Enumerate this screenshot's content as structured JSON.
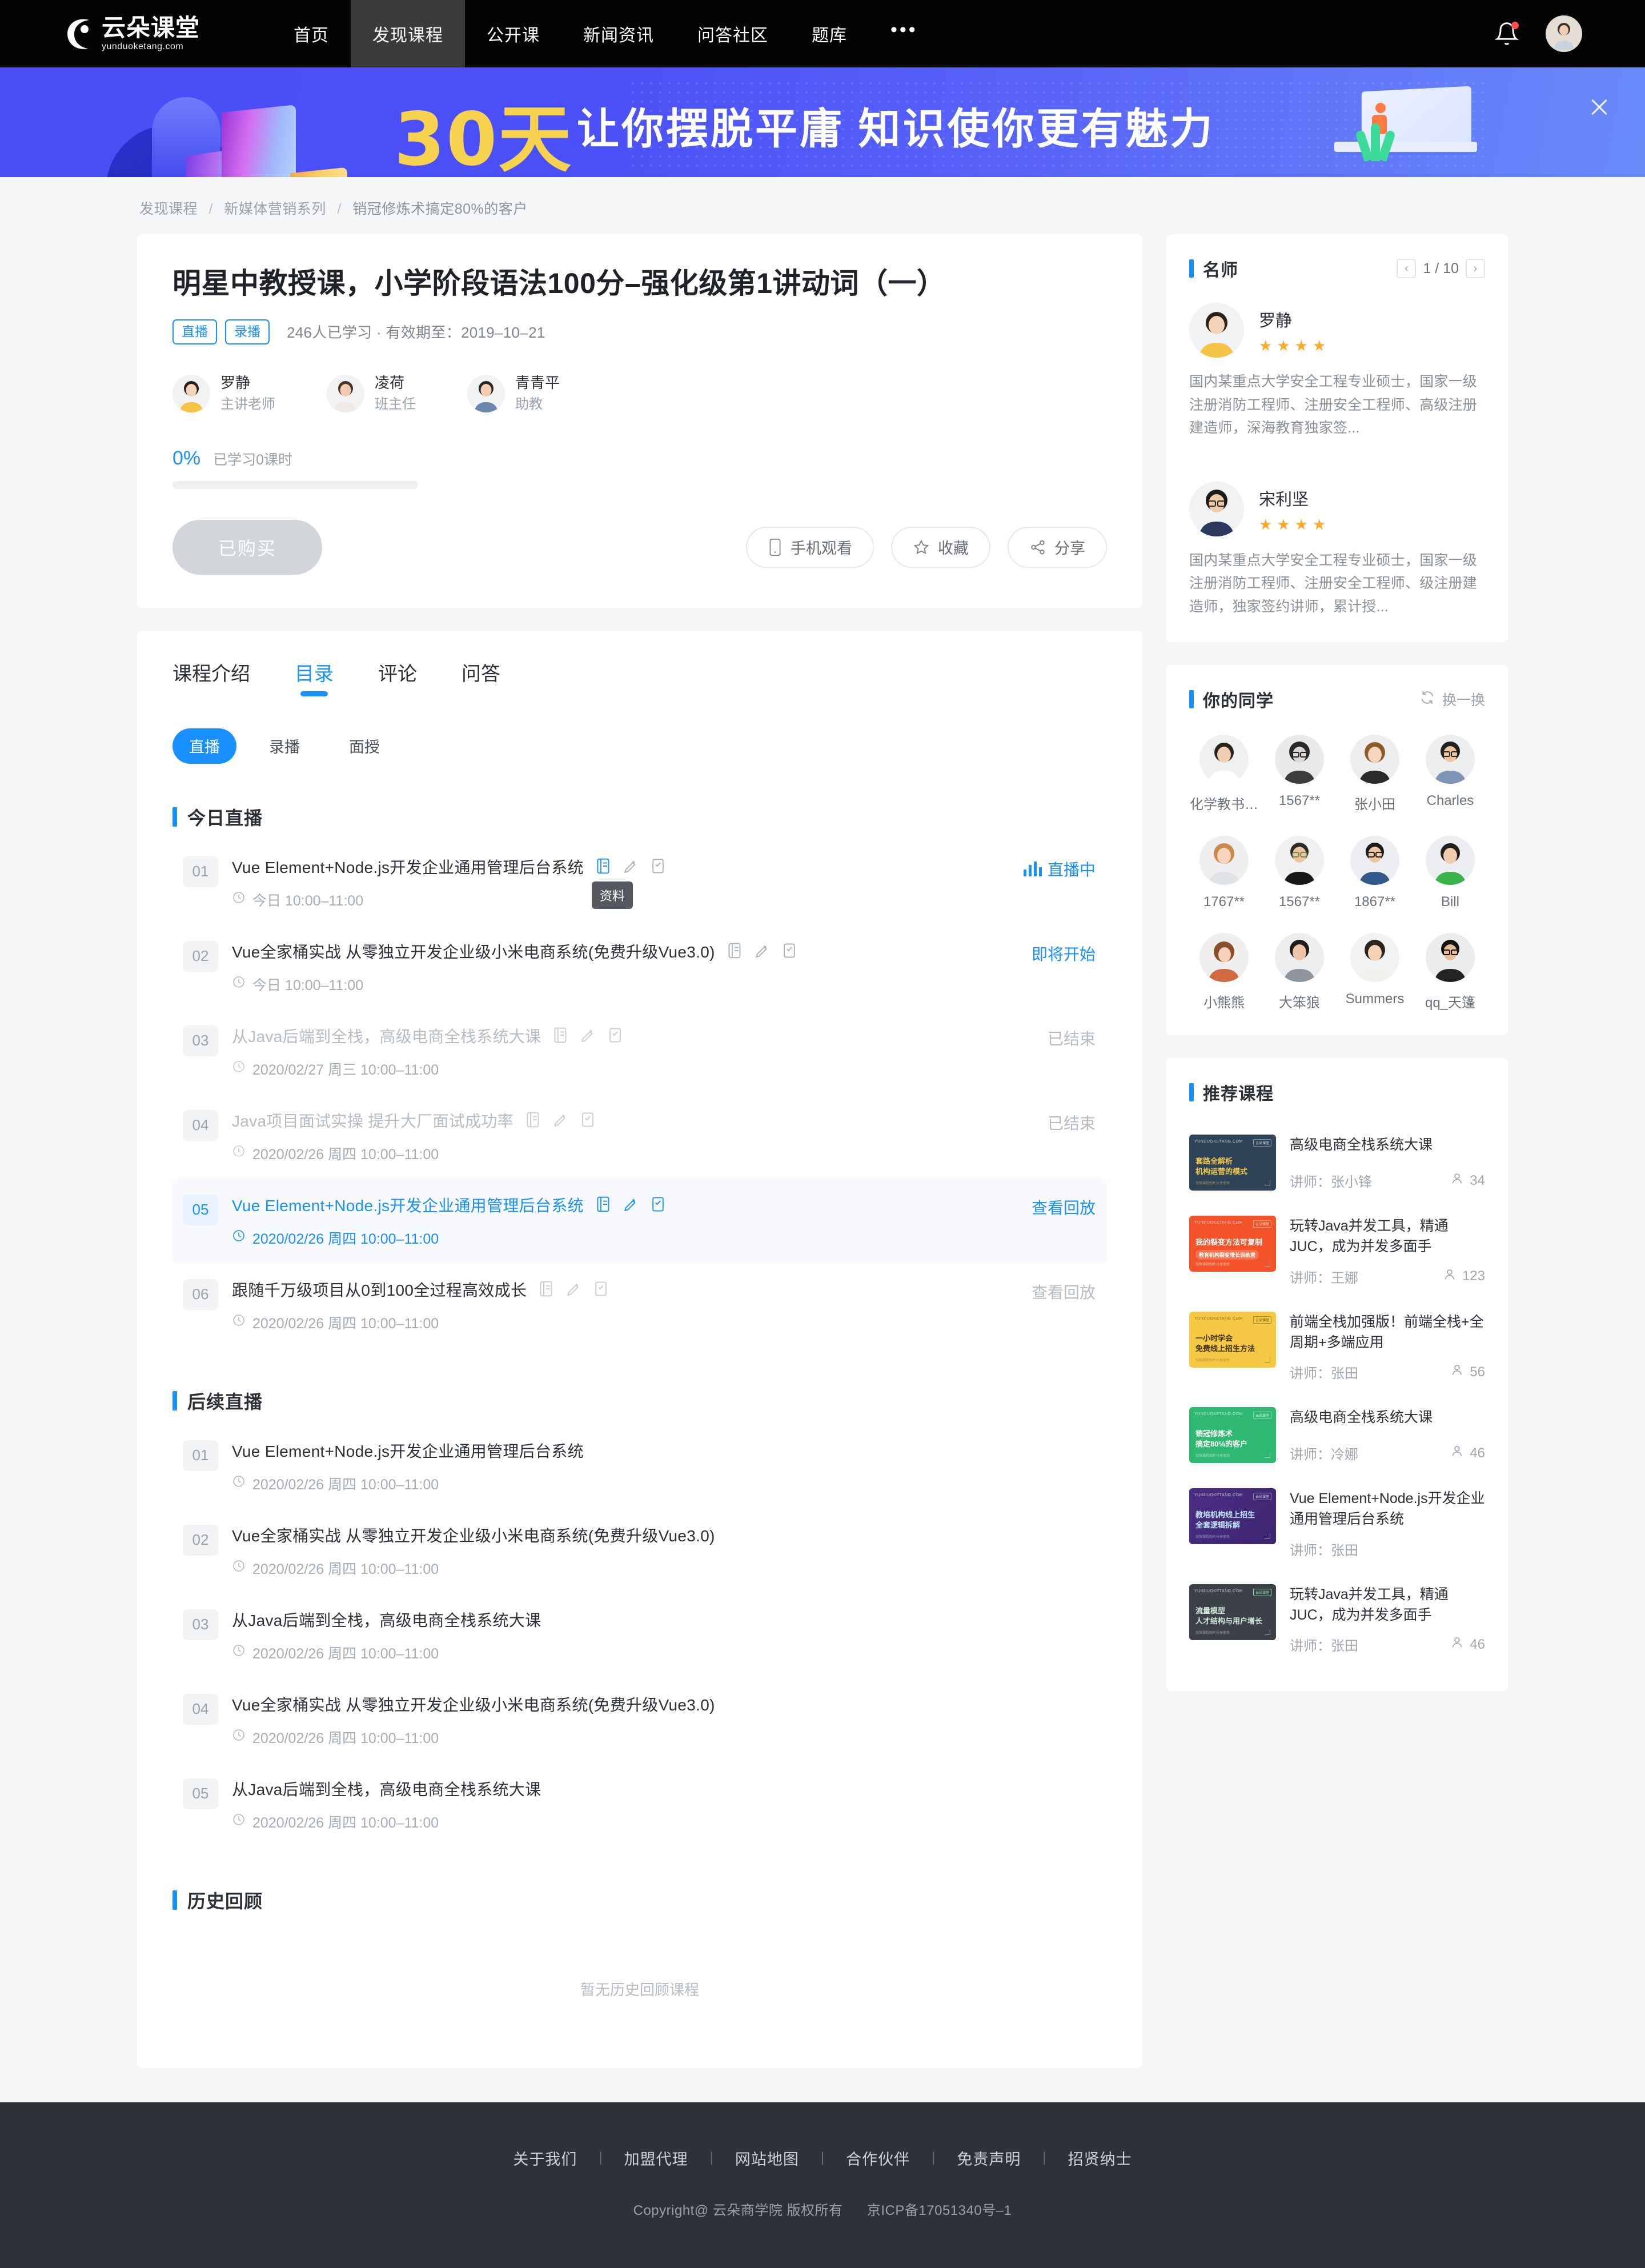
{
  "nav": {
    "logo_cn": "云朵课堂",
    "logo_en": "yunduoketang.com",
    "items": [
      {
        "label": "首页",
        "active": false
      },
      {
        "label": "发现课程",
        "active": true
      },
      {
        "label": "公开课",
        "active": false
      },
      {
        "label": "新闻资讯",
        "active": false
      },
      {
        "label": "问答社区",
        "active": false
      },
      {
        "label": "题库",
        "active": false
      }
    ],
    "more": "•••",
    "bell_icon": "bell-icon",
    "avatar_icon": "user-avatar"
  },
  "banner": {
    "highlight": "30天",
    "text": "让你摆脱平庸 知识使你更有魅力",
    "close_icon": "close-icon"
  },
  "breadcrumb": {
    "items": [
      "发现课程",
      "新媒体营销系列",
      "销冠修炼术搞定80%的客户"
    ],
    "separator": "/"
  },
  "course": {
    "title": "明星中教授课，小学阶段语法100分–强化级第1讲动词（一）",
    "tags": [
      "直播",
      "录播"
    ],
    "meta": "246人已学习 · 有效期至：2019–10–21",
    "teachers": [
      {
        "name": "罗静",
        "role": "主讲老师"
      },
      {
        "name": "凌荷",
        "role": "班主任"
      },
      {
        "name": "青青平",
        "role": "助教"
      }
    ],
    "progress_pct": "0%",
    "progress_label": "已学习0课时",
    "progress_value": 0,
    "buy_button": "已购买",
    "actions": [
      {
        "label": "手机观看",
        "icon": "mobile-icon"
      },
      {
        "label": "收藏",
        "icon": "star-icon"
      },
      {
        "label": "分享",
        "icon": "share-icon"
      }
    ]
  },
  "tabs": [
    {
      "label": "课程介绍",
      "active": false
    },
    {
      "label": "目录",
      "active": true
    },
    {
      "label": "评论",
      "active": false
    },
    {
      "label": "问答",
      "active": false
    }
  ],
  "chips": [
    {
      "label": "直播",
      "active": true
    },
    {
      "label": "录播",
      "active": false
    },
    {
      "label": "面授",
      "active": false
    }
  ],
  "sections": [
    {
      "title": "今日直播",
      "tooltip": "资料",
      "lessons": [
        {
          "num": "01",
          "name": "Vue Element+Node.js开发企业通用管理后台系统",
          "time": "今日 10:00–11:00",
          "status": "直播中",
          "state": "live",
          "icons": true,
          "tooltip": true
        },
        {
          "num": "02",
          "name": "Vue全家桶实战 从零独立开发企业级小米电商系统(免费升级Vue3.0)",
          "time": "今日 10:00–11:00",
          "status": "即将开始",
          "state": "upcoming",
          "icons": true,
          "tooltip": false
        },
        {
          "num": "03",
          "name": "从Java后端到全栈，高级电商全栈系统大课",
          "time": "2020/02/27 周三 10:00–11:00",
          "status": "已结束",
          "state": "ended",
          "icons": true,
          "tooltip": false
        },
        {
          "num": "04",
          "name": "Java项目面试实操 提升大厂面试成功率",
          "time": "2020/02/26 周四 10:00–11:00",
          "status": "已结束",
          "state": "ended",
          "icons": true,
          "tooltip": false
        },
        {
          "num": "05",
          "name": "Vue Element+Node.js开发企业通用管理后台系统",
          "time": "2020/02/26 周四 10:00–11:00",
          "status": "查看回放",
          "state": "highlight",
          "icons": true,
          "tooltip": false
        },
        {
          "num": "06",
          "name": "跟随千万级项目从0到100全过程高效成长",
          "time": "2020/02/26 周四 10:00–11:00",
          "status": "查看回放",
          "state": "replay-dim",
          "icons": true,
          "tooltip": false
        }
      ]
    },
    {
      "title": "后续直播",
      "lessons": [
        {
          "num": "01",
          "name": "Vue Element+Node.js开发企业通用管理后台系统",
          "time": "2020/02/26 周四 10:00–11:00",
          "status": "",
          "state": "plain",
          "icons": false,
          "tooltip": false
        },
        {
          "num": "02",
          "name": "Vue全家桶实战 从零独立开发企业级小米电商系统(免费升级Vue3.0)",
          "time": "2020/02/26 周四 10:00–11:00",
          "status": "",
          "state": "plain",
          "icons": false,
          "tooltip": false
        },
        {
          "num": "03",
          "name": "从Java后端到全栈，高级电商全栈系统大课",
          "time": "2020/02/26 周四 10:00–11:00",
          "status": "",
          "state": "plain",
          "icons": false,
          "tooltip": false
        },
        {
          "num": "04",
          "name": "Vue全家桶实战 从零独立开发企业级小米电商系统(免费升级Vue3.0)",
          "time": "2020/02/26 周四 10:00–11:00",
          "status": "",
          "state": "plain",
          "icons": false,
          "tooltip": false
        },
        {
          "num": "05",
          "name": "从Java后端到全栈，高级电商全栈系统大课",
          "time": "2020/02/26 周四 10:00–11:00",
          "status": "",
          "state": "plain",
          "icons": false,
          "tooltip": false
        }
      ]
    },
    {
      "title": "历史回顾",
      "empty_text": "暂无历史回顾课程",
      "lessons": []
    }
  ],
  "sidebar": {
    "famous_teachers": {
      "title": "名师",
      "pager": {
        "prev_icon": "chevron-left-icon",
        "text": "1 / 10",
        "next_icon": "chevron-right-icon"
      },
      "list": [
        {
          "name": "罗静",
          "stars": 4,
          "desc": "国内某重点大学安全工程专业硕士，国家一级注册消防工程师、注册安全工程师、高级注册建造师，深海教育独家签..."
        },
        {
          "name": "宋利坚",
          "stars": 4,
          "desc": "国内某重点大学安全工程专业硕士，国家一级注册消防工程师、注册安全工程师、级注册建造师，独家签约讲师，累计授..."
        }
      ]
    },
    "classmates": {
      "title": "你的同学",
      "refresh_label": "换一换",
      "refresh_icon": "refresh-icon",
      "list": [
        {
          "name": "化学教书…"
        },
        {
          "name": "1567**"
        },
        {
          "name": "张小田"
        },
        {
          "name": "Charles"
        },
        {
          "name": "1767**"
        },
        {
          "name": "1567**"
        },
        {
          "name": "1867**"
        },
        {
          "name": "Bill"
        },
        {
          "name": "小熊熊"
        },
        {
          "name": "大笨狼"
        },
        {
          "name": "Summers"
        },
        {
          "name": "qq_天篷"
        }
      ]
    },
    "recommended": {
      "title": "推荐课程",
      "teacher_prefix": "讲师：",
      "list": [
        {
          "name": "高级电商全栈系统大课",
          "teacher": "张小锋",
          "count": "34",
          "thumb_color": "#2e4258",
          "thumb_l1": "套路全解析",
          "thumb_l2": "机构运营的模式",
          "thumb_text_color": "#f2c94c",
          "brand": "YUNDUOKETANG.COM",
          "badge": "云朵课堂",
          "foot": "仅限课程图片分享使用"
        },
        {
          "name": "玩转Java并发工具，精通JUC，成为并发多面手",
          "teacher": "王娜",
          "count": "123",
          "thumb_color": "#f4532a",
          "thumb_l1": "我的裂变方法可复制",
          "thumb_l2": "教育机构裂变增长训练营",
          "thumb_text_color": "#ffffff",
          "brand": "YUNDUOKETANG.COM",
          "badge": "云朵课堂",
          "foot": "仅限课程图片分享使用"
        },
        {
          "name": "前端全栈加强版！前端全栈+全周期+多端应用",
          "teacher": "张田",
          "count": "56",
          "thumb_color": "#f6c945",
          "thumb_l1": "一小时学会",
          "thumb_l2": "免费线上招生方法",
          "thumb_text_color": "#3d3010",
          "brand": "YUNDUOKETANG.COM",
          "badge": "云朵课堂",
          "foot": "仅限课程图片分享使用"
        },
        {
          "name": "高级电商全栈系统大课",
          "teacher": "冷娜",
          "count": "46",
          "thumb_color": "#2eb872",
          "thumb_l1": "销冠修炼术",
          "thumb_l2": "搞定80%的客户",
          "thumb_text_color": "#ffffff",
          "brand": "YUNDUOKETANG.COM",
          "badge": "云朵课堂",
          "foot": "仅限课程图片分享使用"
        },
        {
          "name": "Vue Element+Node.js开发企业通用管理后台系统",
          "teacher": "张田",
          "count": "",
          "thumb_color": "#4b2e83",
          "thumb_l1": "教培机构线上招生",
          "thumb_l2": "全套逻辑拆解",
          "thumb_text_color": "#bfe6fb",
          "brand": "YUNDUOKETANG.COM",
          "badge": "云朵课堂",
          "foot": "仅限课程图片分享使用"
        },
        {
          "name": "玩转Java并发工具，精通JUC，成为并发多面手",
          "teacher": "张田",
          "count": "46",
          "thumb_color": "#3c4048",
          "thumb_l1": "流量模型",
          "thumb_l2": "人才结构与用户增长",
          "thumb_text_color": "#cfe8d8",
          "brand": "YUNDUOKETANG.COM",
          "badge": "云朵课堂",
          "foot": "仅限课程图片分享使用"
        }
      ]
    }
  },
  "footer": {
    "links": [
      "关于我们",
      "加盟代理",
      "网站地图",
      "合作伙伴",
      "免责声明",
      "招贤纳士"
    ],
    "separator": "|",
    "copyright": "Copyright@ 云朵商学院   版权所有",
    "icp": "京ICP备17051340号–1"
  },
  "colors": {
    "accent": "#1890ff",
    "nav_bg": "#040404",
    "footer_bg": "#2e3138",
    "page_bg": "#f5f6f8",
    "star": "#fdab28"
  }
}
